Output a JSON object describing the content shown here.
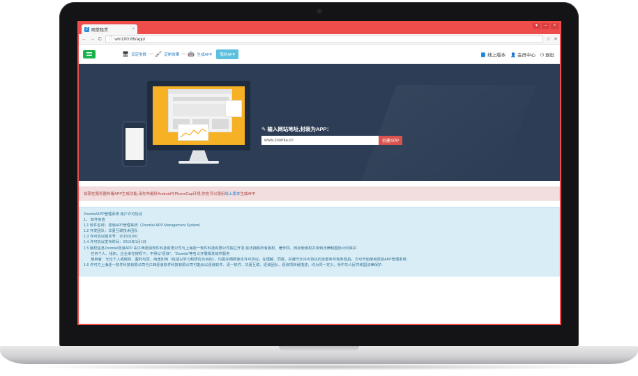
{
  "browser": {
    "tab_title": "随堂租赁",
    "favicon_text": "Z",
    "tab_close": "×",
    "url_page": "🗋",
    "url": "win100:86/app/",
    "window_buttons": [
      "▾",
      "–",
      "×"
    ],
    "nav_back": "←",
    "nav_forward": "→",
    "nav_reload": "C",
    "star": "☆",
    "menu": "≡"
  },
  "header": {
    "steps": [
      {
        "icon": "monitor-icon",
        "glyph": "🖥",
        "label": "设定参数"
      },
      {
        "icon": "brush-icon",
        "glyph": "🖌",
        "label": "定制效果"
      },
      {
        "icon": "android-icon",
        "glyph": "🤖",
        "label": "生成APP"
      }
    ],
    "step_separator": "------",
    "my_app_button": "我的APP",
    "links": [
      {
        "icon": "book-icon",
        "glyph": "📘",
        "label": "线上版本"
      },
      {
        "icon": "user-icon",
        "glyph": "👤",
        "label": "会员中心"
      },
      {
        "icon": "power-icon",
        "glyph": "⏻",
        "label": "退出"
      }
    ]
  },
  "hero": {
    "label": "✎ 输入网站地址,封装为APP：",
    "input_value": "www.zoomla.cn",
    "button": "创建APP",
    "bg_color": "#2c3d55",
    "screen_color": "#f6b124"
  },
  "notice": {
    "text_before": "如需在服务器布署APP生成功能,请先布署好Android与PhoneGap环境,你也可以使用",
    "link": "线上版本",
    "text_after": "生成APP"
  },
  "license": {
    "lines": [
      {
        "text": "Zoomla!APP管理系统 用户许可协议",
        "indent": false
      },
      {
        "text": "1、 软件信息",
        "indent": false
      },
      {
        "text": "1.1 软件名称：逐浪APP管理系统（Zoomla! APP Management System）",
        "indent": false
      },
      {
        "text": "1.2 开发团队：华夏互联技术团队",
        "indent": false
      },
      {
        "text": "1.3 许可协议版本号：201501001",
        "indent": false
      },
      {
        "text": "1.4 许可协议发布时间：2015年1月1日",
        "indent": false
      },
      {
        "text": "1.5 版权信息Zoomla!逐浪APP 由江西逐浪软件科技有限公司与上海逐一软件科技有限公司独立开发,依法拥有所有版权、著作权、商标使用权并受到法律和国际公约保护.",
        "indent": false
      },
      {
        "text": "任何个人、组织、企业未在授权下，不得以“逐浪”、“Zoomla”等名义开展相关软件服务",
        "indent": true
      },
      {
        "text": "使用者：无论个人或组织、盈利与否、用途如何（包括以学习和研究为目的），均需仔细阅读本许可协议，在理解、同意、并遵守本许可协议的全部条件和条款后，方可开始使用逐浪APP管理系统.",
        "indent": true
      },
      {
        "text": "1.6 许可方上海逐一软件科技有限公司与江西逐浪软件科技有限公司可能会以逐浪软件、逐一软件、华夏互联、逐浪团队、逐浪项目组描述，均为同一定义，受中华人民共和国法律保护.",
        "indent": false
      }
    ]
  }
}
